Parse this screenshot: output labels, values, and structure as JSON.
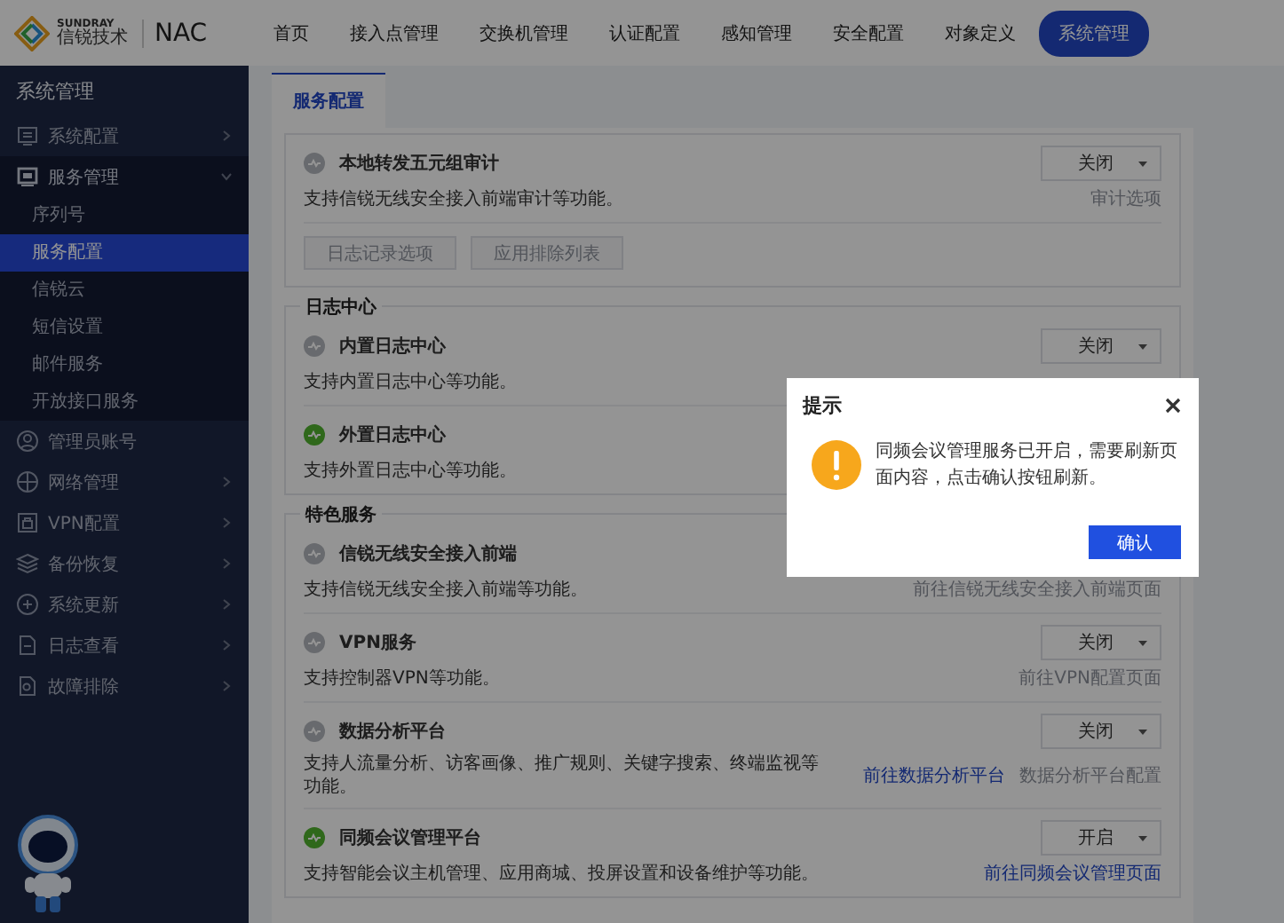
{
  "header": {
    "brand_en": "SUNDRAY",
    "brand_cn": "信锐技术",
    "product": "NAC",
    "nav": [
      {
        "label": "首页",
        "selected": false
      },
      {
        "label": "接入点管理",
        "selected": false
      },
      {
        "label": "交换机管理",
        "selected": false
      },
      {
        "label": "认证配置",
        "selected": false
      },
      {
        "label": "感知管理",
        "selected": false
      },
      {
        "label": "安全配置",
        "selected": false
      },
      {
        "label": "对象定义",
        "selected": false
      },
      {
        "label": "系统管理",
        "selected": true
      }
    ]
  },
  "sidebar": {
    "title": "系统管理",
    "items": [
      {
        "label": "系统配置",
        "expanded": false,
        "has_submenu": true
      },
      {
        "label": "服务管理",
        "expanded": true,
        "has_submenu": true,
        "children": [
          {
            "label": "序列号",
            "selected": false
          },
          {
            "label": "服务配置",
            "selected": true
          },
          {
            "label": "信锐云",
            "selected": false
          },
          {
            "label": "短信设置",
            "selected": false
          },
          {
            "label": "邮件服务",
            "selected": false
          },
          {
            "label": "开放接口服务",
            "selected": false
          }
        ]
      },
      {
        "label": "管理员账号",
        "expanded": false,
        "has_submenu": false
      },
      {
        "label": "网络管理",
        "expanded": false,
        "has_submenu": true
      },
      {
        "label": "VPN配置",
        "expanded": false,
        "has_submenu": true
      },
      {
        "label": "备份恢复",
        "expanded": false,
        "has_submenu": true
      },
      {
        "label": "系统更新",
        "expanded": false,
        "has_submenu": true
      },
      {
        "label": "日志查看",
        "expanded": false,
        "has_submenu": true
      },
      {
        "label": "故障排除",
        "expanded": false,
        "has_submenu": true
      }
    ]
  },
  "tabs": [
    {
      "label": "服务配置",
      "selected": true
    }
  ],
  "sections": [
    {
      "items": [
        {
          "name": "本地转发五元组审计",
          "on": false,
          "dropdown": "关闭",
          "description": "支持信锐无线安全接入前端审计等功能。",
          "links": [
            {
              "text": "审计选项",
              "disabled": true
            }
          ]
        }
      ],
      "buttons": [
        {
          "label": "日志记录选项",
          "disabled": true
        },
        {
          "label": "应用排除列表",
          "disabled": true
        }
      ]
    },
    {
      "title": "日志中心",
      "items": [
        {
          "name": "内置日志中心",
          "on": false,
          "dropdown": "关闭",
          "description": "支持内置日志中心等功能。"
        },
        {
          "name": "外置日志中心",
          "on": true,
          "description": "支持外置日志中心等功能。"
        }
      ]
    },
    {
      "title": "特色服务",
      "items": [
        {
          "name": "信锐无线安全接入前端",
          "on": false,
          "description": "支持信锐无线安全接入前端等功能。",
          "links": [
            {
              "text": "前往信锐无线安全接入前端页面",
              "disabled": true
            }
          ]
        },
        {
          "name": "VPN服务",
          "on": false,
          "dropdown": "关闭",
          "description": "支持控制器VPN等功能。",
          "links": [
            {
              "text": "前往VPN配置页面",
              "disabled": true
            }
          ]
        },
        {
          "name": "数据分析平台",
          "on": false,
          "dropdown": "关闭",
          "description": "支持人流量分析、访客画像、推广规则、关键字搜索、终端监视等功能。",
          "links": [
            {
              "text": "前往数据分析平台",
              "disabled": false
            },
            {
              "text": "数据分析平台配置",
              "disabled": true
            }
          ]
        },
        {
          "name": "同频会议管理平台",
          "on": true,
          "dropdown": "开启",
          "description": "支持智能会议主机管理、应用商城、投屏设置和设备维护等功能。",
          "links": [
            {
              "text": "前往同频会议管理页面",
              "disabled": false
            }
          ]
        }
      ]
    }
  ],
  "dialog": {
    "title": "提示",
    "message": "同频会议管理服务已开启，需要刷新页面内容，点击确认按钮刷新。",
    "button": "确认"
  }
}
